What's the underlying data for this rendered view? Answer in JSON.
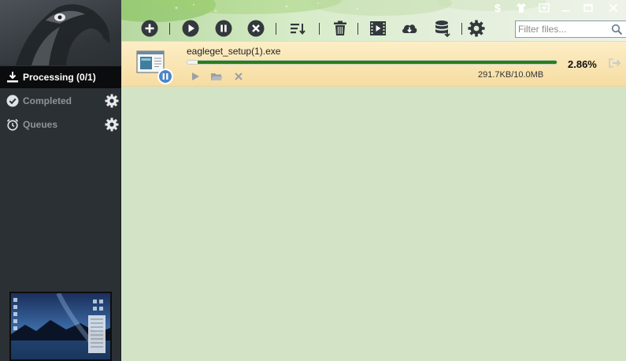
{
  "app": {
    "name": "EagleGet"
  },
  "sidebar": {
    "items": [
      {
        "label": "Processing (0/1)",
        "icon": "download-tray-icon",
        "active": true
      },
      {
        "label": "Completed",
        "icon": "check-circle-icon",
        "settings_icon": "gear-icon"
      },
      {
        "label": "Queues",
        "icon": "alarm-clock-icon",
        "settings_icon": "gear-icon"
      }
    ]
  },
  "toolbar": {
    "buttons": [
      "add-icon",
      "start-icon",
      "pause-icon",
      "stop-icon",
      "sort-icon",
      "delete-icon",
      "video-icon",
      "cloud-download-icon",
      "database-icon",
      "settings-icon"
    ]
  },
  "window_controls": [
    "dollar-icon",
    "skin-icon",
    "menu-dropdown-icon",
    "minimize-icon",
    "maximize-icon",
    "close-icon"
  ],
  "filter": {
    "placeholder": "Filter files...",
    "value": ""
  },
  "task": {
    "filename": "eagleget_setup(1).exe",
    "progress_percent": 2.86,
    "progress_label": "2.86%",
    "size_text": "291.7KB/10.0MB",
    "actions": [
      "play-icon",
      "folder-icon",
      "remove-icon"
    ]
  },
  "colors": {
    "sidebar_bg": "#2b3035",
    "content_bg": "#d2e4c5",
    "progress_green": "#2f8a1f",
    "task_row_bg": "#f8e1a9"
  }
}
